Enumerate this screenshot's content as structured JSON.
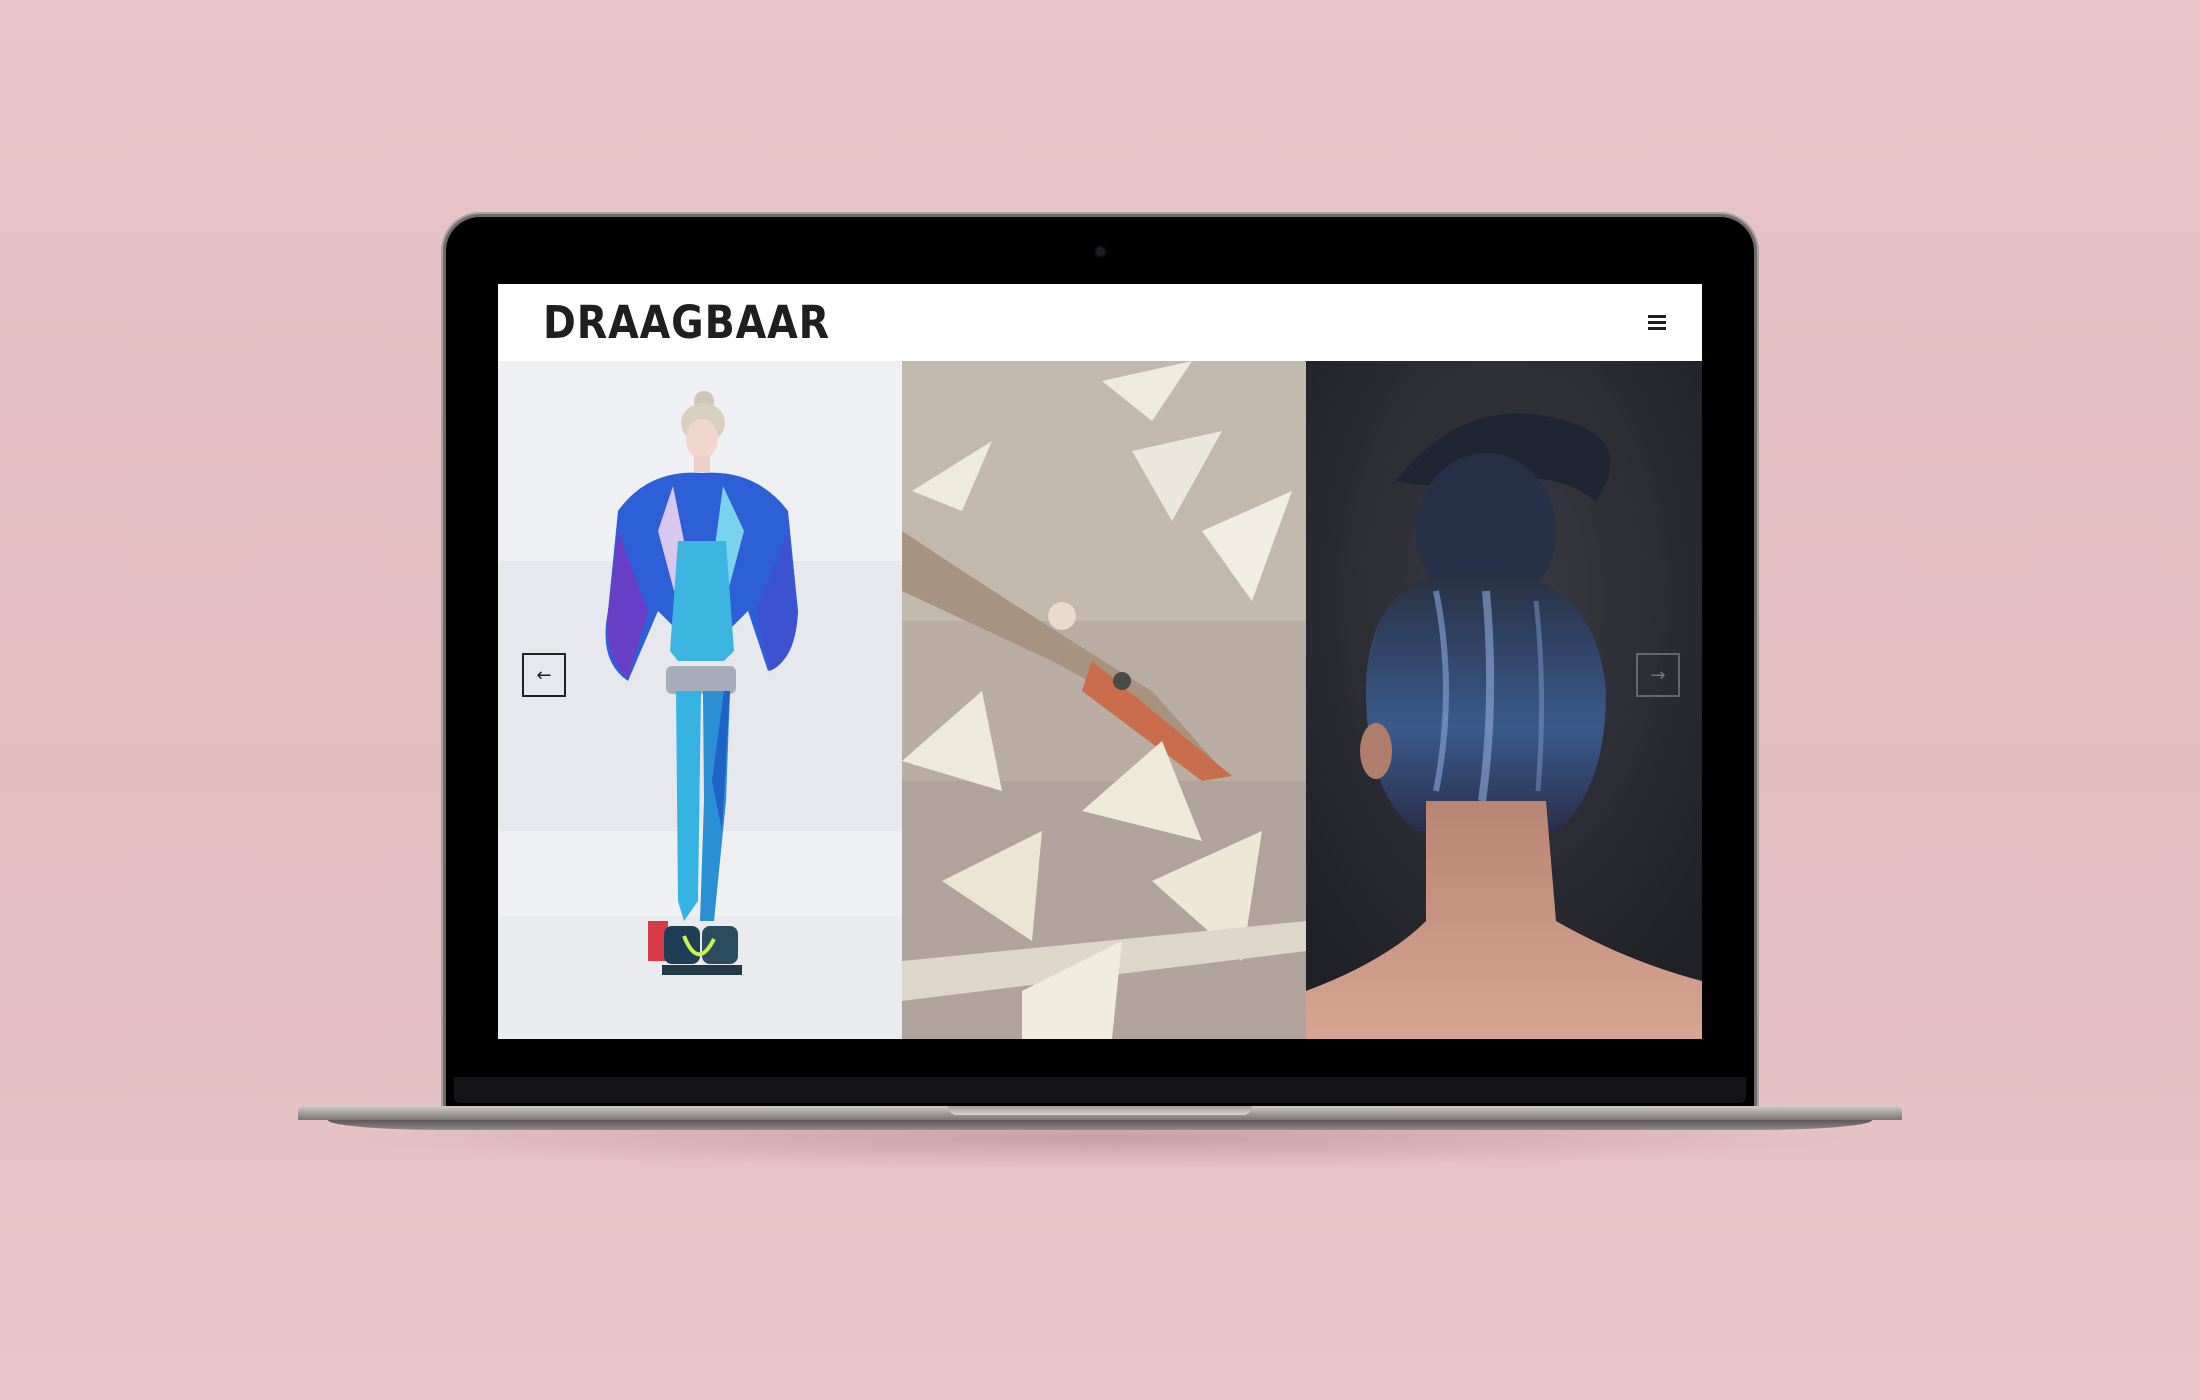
{
  "site": {
    "logo": "DRAAGBAAR",
    "menu_icon": "hamburger-menu-icon"
  },
  "gallery": {
    "prev_arrow": "←",
    "next_arrow": "→",
    "images": [
      "fashion-model-fur-jacket-image",
      "illustrated-bird-painting-image",
      "blue-hair-bun-back-view-image"
    ]
  },
  "colors": {
    "background": "#e5c2c5",
    "screen_bezel": "#000000",
    "header_bg": "#ffffff",
    "logo_text": "#1f1f1f"
  }
}
